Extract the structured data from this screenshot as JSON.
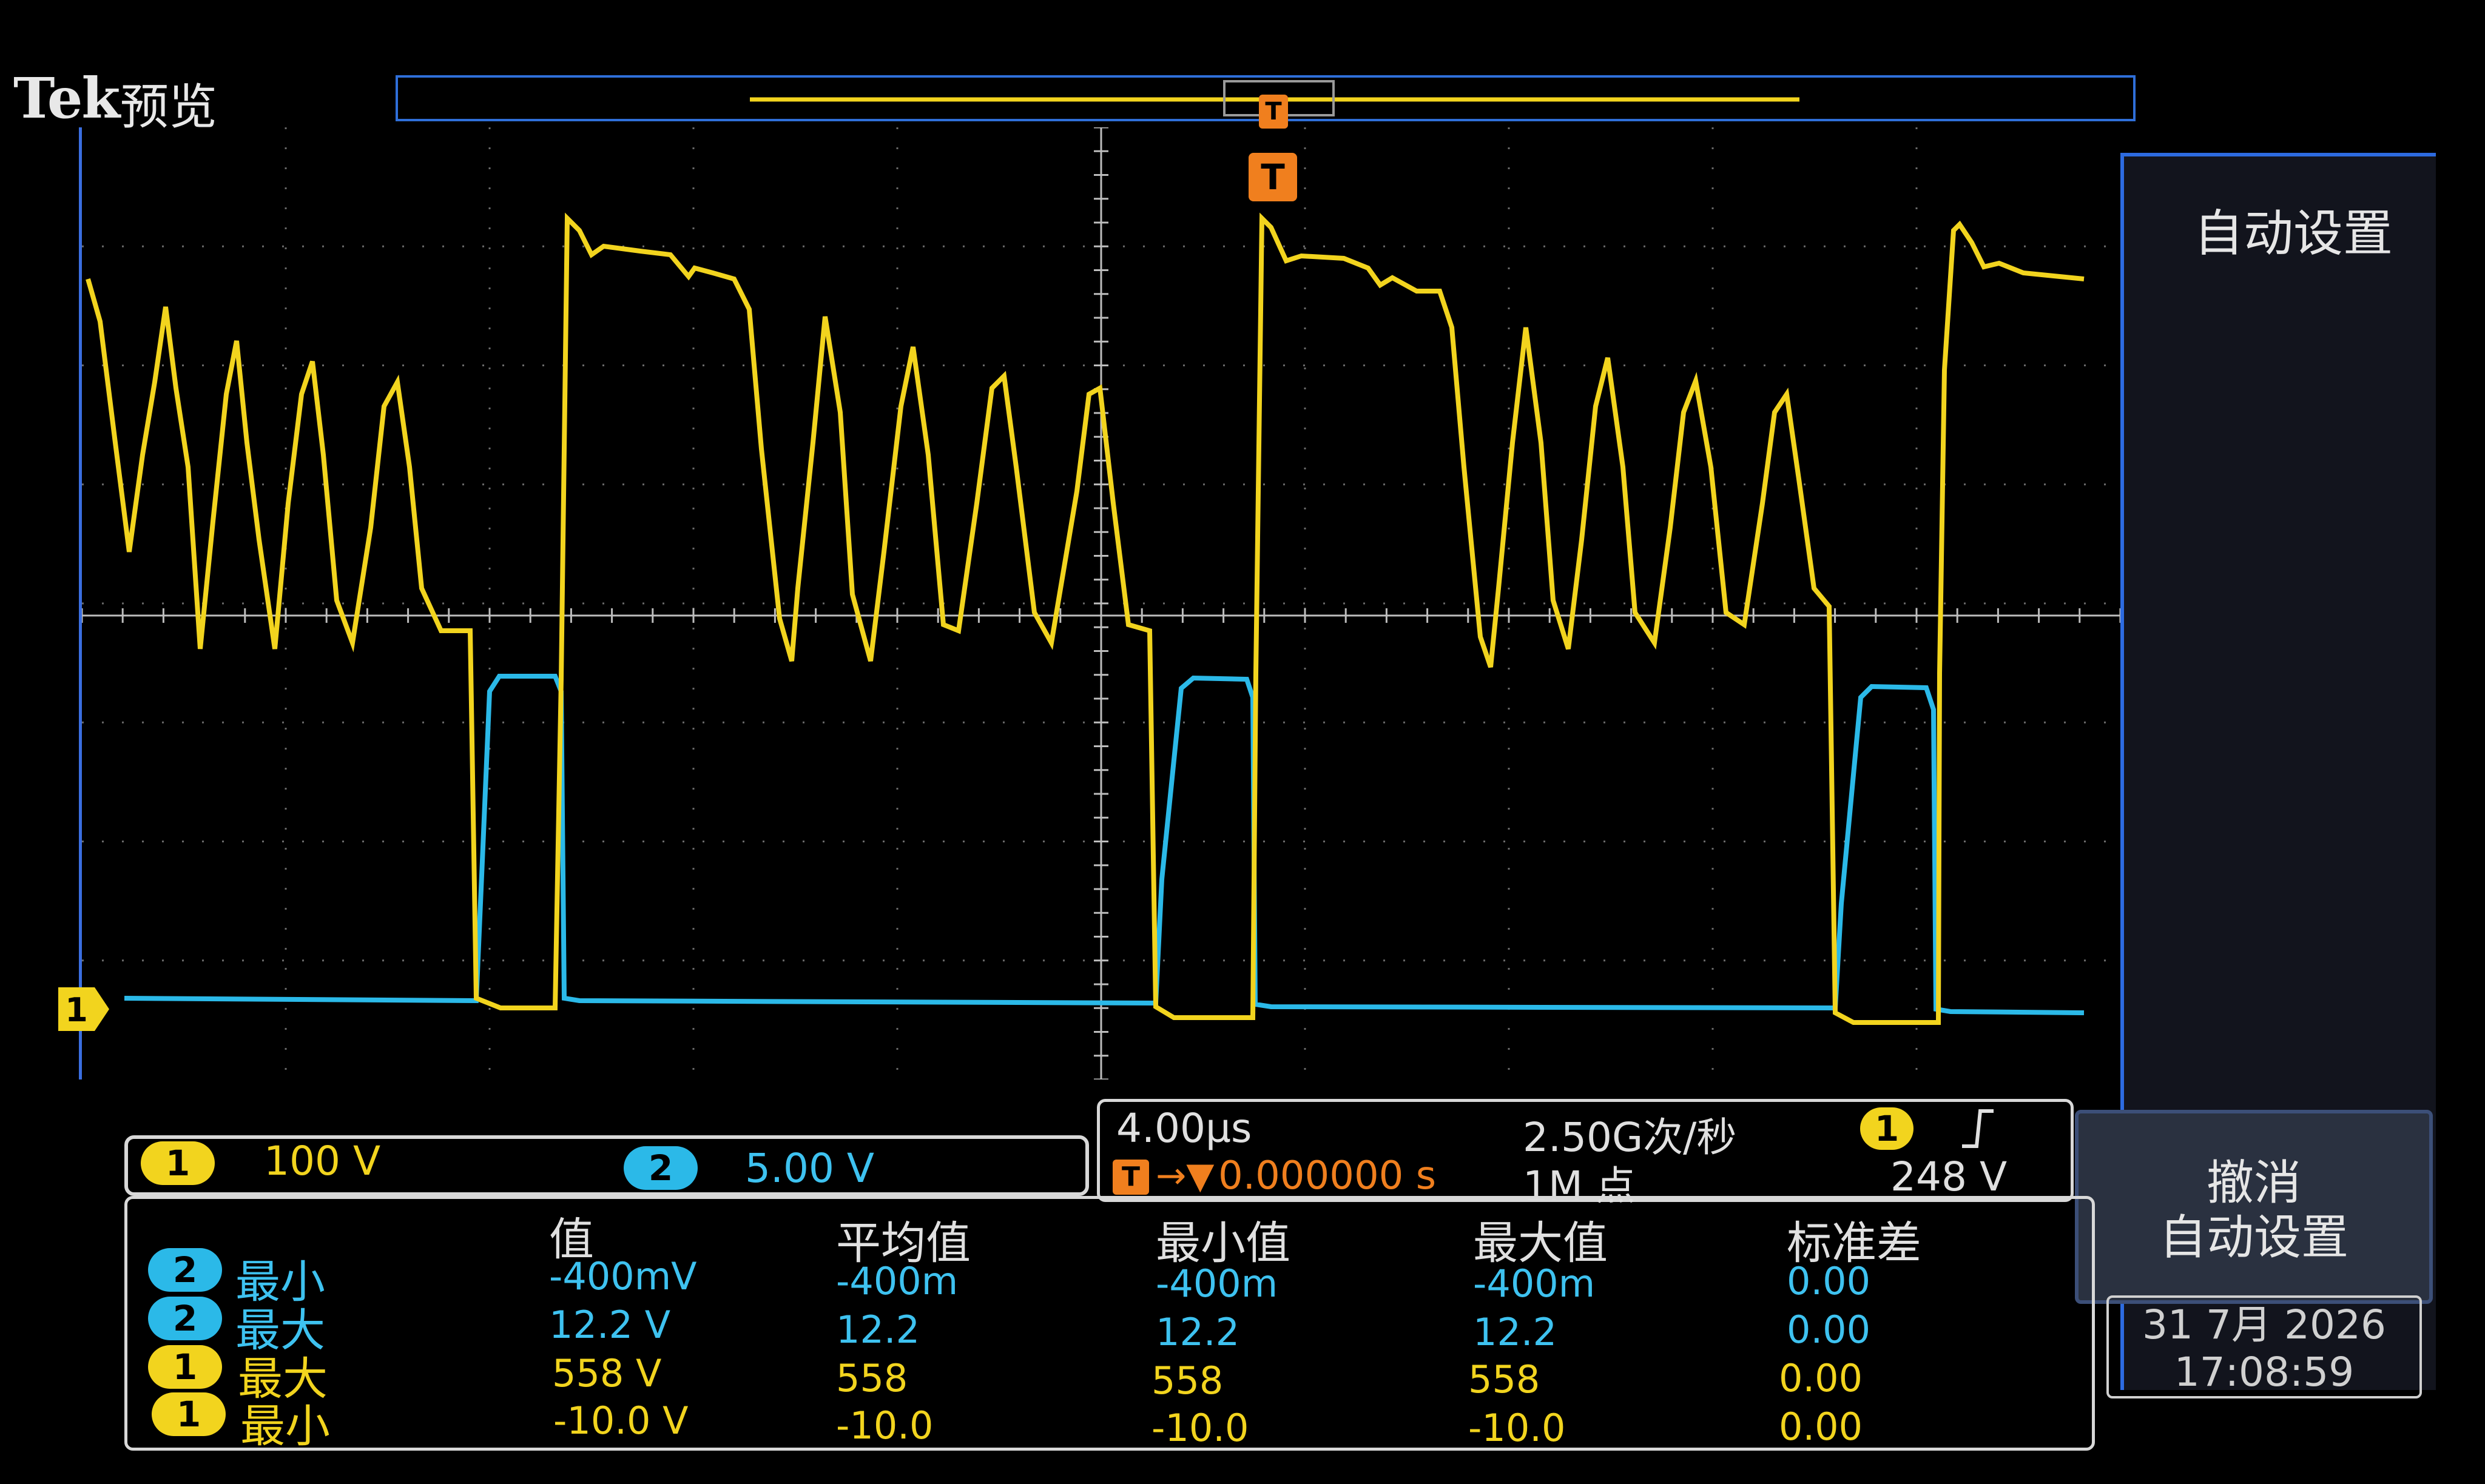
{
  "header": {
    "brand": "Tek",
    "mode": "预览"
  },
  "trigger_marker": "T",
  "ch1_marker": "1",
  "right_panel": {
    "autoset_title": "自动设置",
    "undo_line1": "撤消",
    "undo_line2": "自动设置",
    "date": "31 7月 2026",
    "time": "17:08:59"
  },
  "channels": [
    {
      "number": "1",
      "scale": "100 V",
      "color": "#f2d41e"
    },
    {
      "number": "2",
      "scale": "5.00 V",
      "color": "#2bb9e8"
    }
  ],
  "timebase": {
    "horizontal_scale": "4.00µs",
    "sample_rate": "2.50G次/秒",
    "trigger_delay": "0.000000 s",
    "record_length": "1M 点",
    "trigger_source": "1",
    "trigger_level": "248 V",
    "trigger_slope_icon": "rising-edge-icon"
  },
  "measurements": {
    "headers": [
      "值",
      "平均值",
      "最小值",
      "最大值",
      "标准差"
    ],
    "rows": [
      {
        "channel": "2",
        "name": "最小",
        "value": "-400mV",
        "mean": "-400m",
        "min": "-400m",
        "max": "-400m",
        "std": "0.00"
      },
      {
        "channel": "2",
        "name": "最大",
        "value": "12.2 V",
        "mean": "12.2",
        "min": "12.2",
        "max": "12.2",
        "std": "0.00"
      },
      {
        "channel": "1",
        "name": "最大",
        "value": "558 V",
        "mean": "558",
        "min": "558",
        "max": "558",
        "std": "0.00"
      },
      {
        "channel": "1",
        "name": "最小",
        "value": "-10.0 V",
        "mean": "-10.0",
        "min": "-10.0",
        "max": "-10.0",
        "std": "0.00"
      }
    ]
  },
  "colors": {
    "ch1": "#f2d41e",
    "ch2": "#2bb9e8",
    "trigger": "#f07f1e",
    "frame": "#2d6be0"
  }
}
